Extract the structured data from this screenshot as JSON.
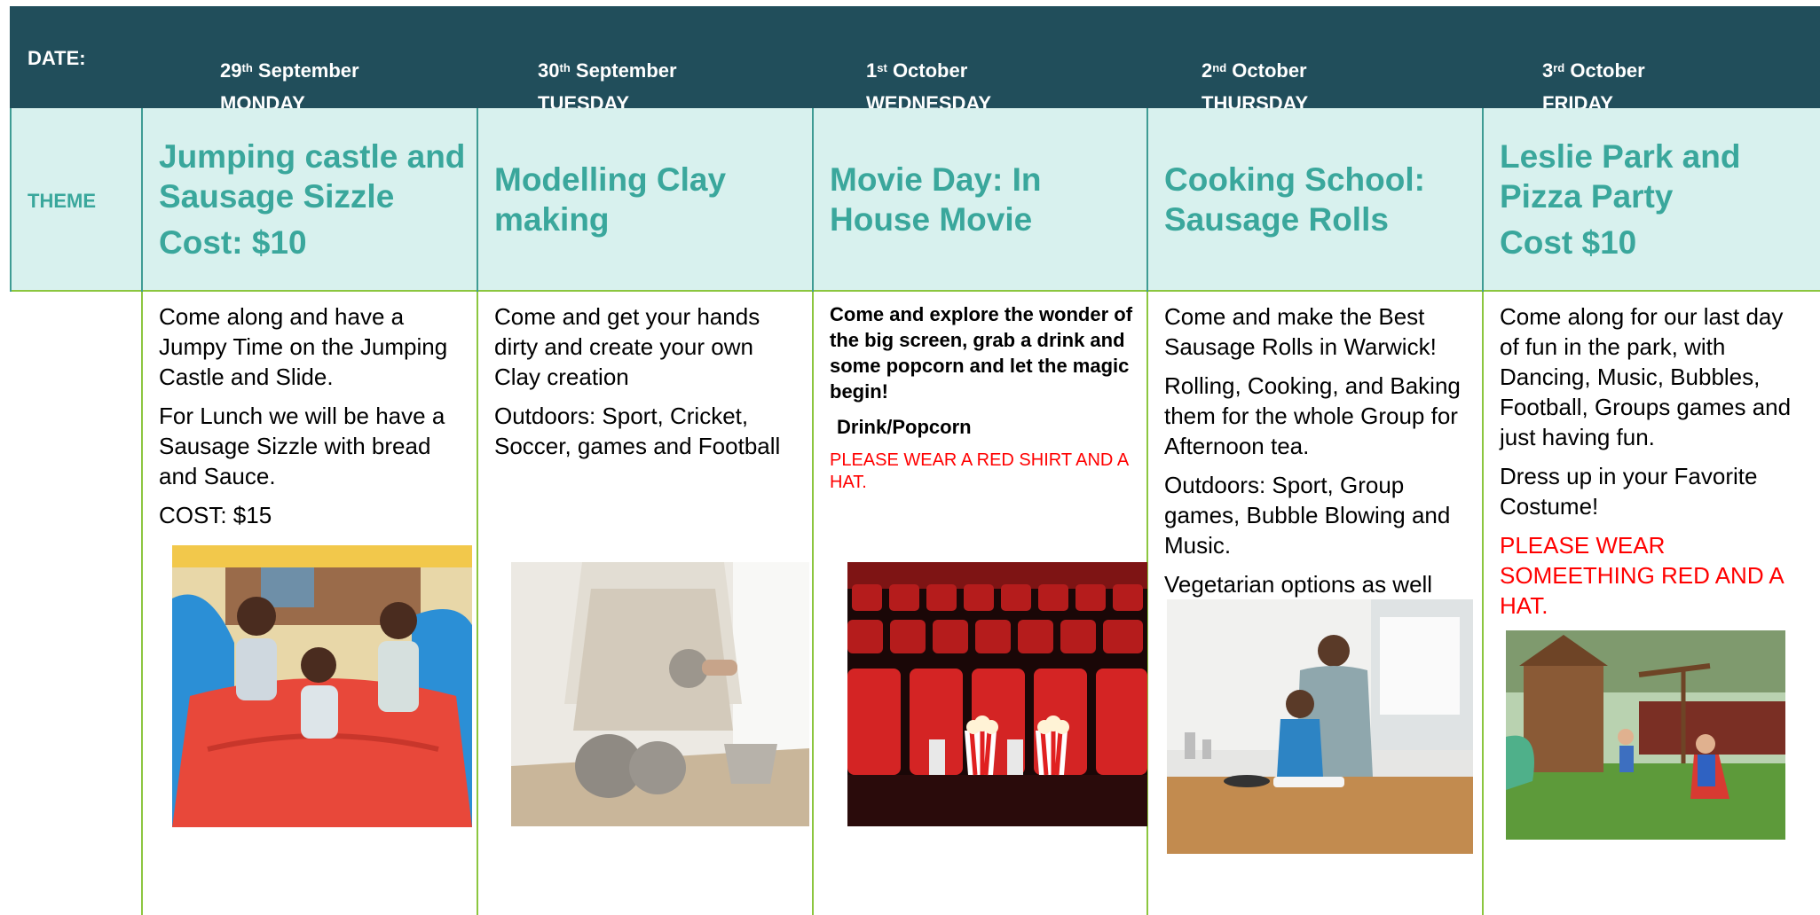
{
  "header": {
    "date_label": "DATE:",
    "days": [
      {
        "num": "29",
        "suffix": "th",
        "month": "September",
        "weekday": "MONDAY"
      },
      {
        "num": "30",
        "suffix": "th",
        "month": "September",
        "weekday": "TUESDAY"
      },
      {
        "num": "1",
        "suffix": "st",
        "month": "October",
        "weekday": "WEDNESDAY"
      },
      {
        "num": "2",
        "suffix": "nd",
        "month": "October",
        "weekday": "THURSDAY"
      },
      {
        "num": "3",
        "suffix": "rd",
        "month": "October",
        "weekday": "FRIDAY"
      }
    ]
  },
  "theme": {
    "label": "THEME",
    "cells": [
      {
        "title": "Jumping castle and Sausage Sizzle",
        "cost": "Cost: $10"
      },
      {
        "title": "Modelling Clay making",
        "cost": ""
      },
      {
        "title": "Movie Day: In House Movie",
        "cost": ""
      },
      {
        "title": "Cooking School: Sausage Rolls",
        "cost": ""
      },
      {
        "title": "Leslie Park and Pizza Party",
        "cost": "Cost $10"
      }
    ]
  },
  "details": {
    "monday": [
      "Come along and have a Jumpy Time on the Jumping Castle and Slide.",
      "For Lunch we will be have a Sausage Sizzle with bread and Sauce.",
      "COST: $15"
    ],
    "tuesday": [
      "Come and get your hands dirty and create your own Clay creation",
      "Outdoors: Sport, Cricket, Soccer, games and Football"
    ],
    "wednesday": [
      "Come and explore the wonder of the big screen, grab a drink and some popcorn and let the magic begin!",
      "Drink/Popcorn",
      "PLEASE WEAR A RED SHIRT AND A HAT."
    ],
    "thursday": [
      "Come and make the Best Sausage Rolls in Warwick!",
      "Rolling, Cooking, and Baking them for the whole Group for Afternoon tea.",
      "Outdoors: Sport, Group games, Bubble Blowing and Music.",
      "Vegetarian options as well"
    ],
    "friday": [
      "Come along for our last day of fun in the park, with Dancing, Music, Bubbles, Football, Groups games and just having fun.",
      "Dress up in your Favorite Costume!",
      "PLEASE WEAR SOMEETHING RED AND A HAT."
    ]
  },
  "colors": {
    "header_bg": "#214e5b",
    "theme_bg": "#d8f1ee",
    "theme_text": "#3aa79c",
    "grid_green": "#8cc63f",
    "warning_red": "#ff0000"
  }
}
